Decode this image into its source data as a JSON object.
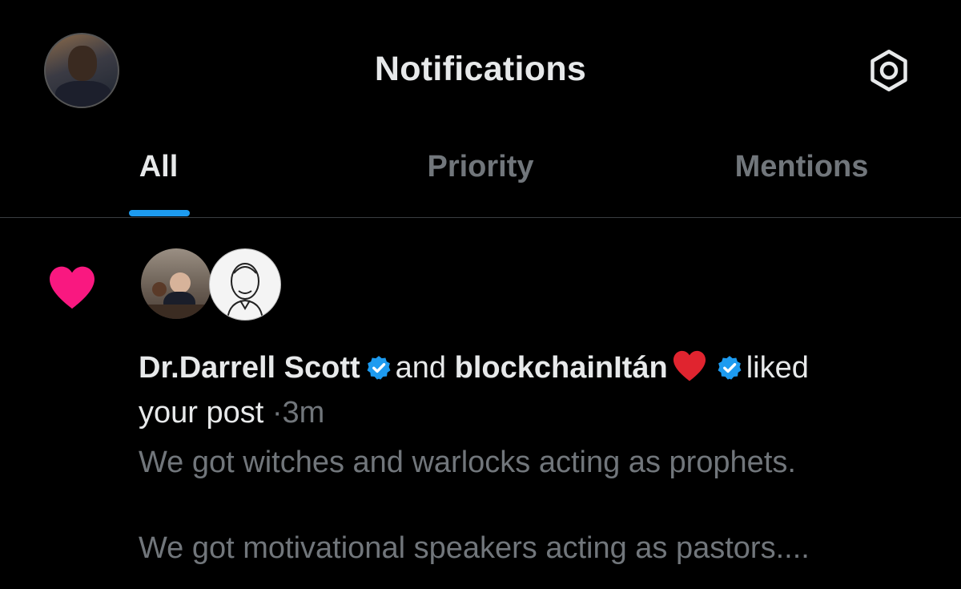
{
  "header": {
    "title": "Notifications",
    "avatar_icon": "user-avatar",
    "settings_icon": "gear-icon"
  },
  "tabs": [
    {
      "label": "All",
      "active": true
    },
    {
      "label": "Priority",
      "active": false
    },
    {
      "label": "Mentions",
      "active": false
    }
  ],
  "notification": {
    "type_icon": "heart-icon",
    "type_color": "#f91880",
    "user1": "Dr.Darrell Scott",
    "connector": "and",
    "user2": "blockchainItán",
    "action_part1": "liked",
    "action_part2": "your post",
    "separator": "·",
    "time": "3m",
    "post_line1": "We got witches and warlocks acting as prophets.",
    "post_line2": "We got motivational speakers acting as pastors...."
  },
  "colors": {
    "background": "#000000",
    "accent": "#1d9bf0",
    "text": "#e7e9ea",
    "muted": "#71767b",
    "like": "#f91880"
  }
}
